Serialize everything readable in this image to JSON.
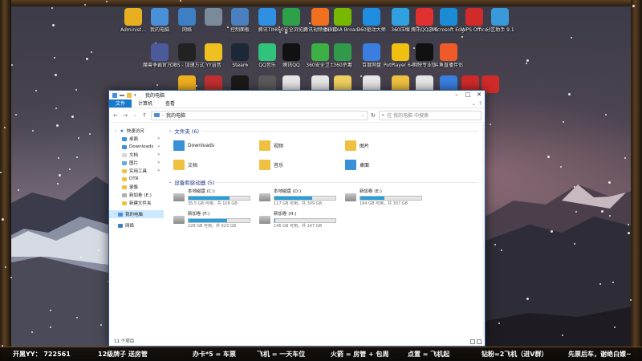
{
  "desktop": {
    "icons": [
      {
        "label": "Administ...",
        "color": "#e8b020",
        "glyph": "",
        "icon": "user-folder-icon"
      },
      {
        "label": "我的电脑",
        "color": "#4a90d9",
        "glyph": "",
        "icon": "computer-icon"
      },
      {
        "label": "网络",
        "color": "#3c7fc4",
        "glyph": "",
        "icon": "network-icon"
      },
      {
        "label": "",
        "color": "#7a8a9a",
        "glyph": "",
        "icon": "app-icon"
      },
      {
        "label": "控制面板",
        "color": "#4a7fc0",
        "glyph": "",
        "icon": "control-panel-icon"
      },
      {
        "label": "腾讯TIM",
        "color": "#2f8fe0",
        "glyph": "",
        "icon": "tim-icon"
      },
      {
        "label": "360安全浏览器",
        "color": "#2ea04a",
        "glyph": "",
        "icon": "360-browser-icon"
      },
      {
        "label": "腾讯视频播放器",
        "color": "#f07020",
        "glyph": "",
        "icon": "tencent-video-icon"
      },
      {
        "label": "NVIDIA Broadcast",
        "color": "#76b900",
        "glyph": "",
        "icon": "nvidia-icon"
      },
      {
        "label": "360驱动大师",
        "color": "#1f8de0",
        "glyph": "",
        "icon": "360-driver-icon"
      },
      {
        "label": "360压缩",
        "color": "#2fa0e0",
        "glyph": "",
        "icon": "360-zip-icon"
      },
      {
        "label": "腾讯QQ游戏",
        "color": "#e03030",
        "glyph": "",
        "icon": "qq-game-icon"
      },
      {
        "label": "Microsoft Edge",
        "color": "#1b8bd6",
        "glyph": "",
        "icon": "edge-icon"
      },
      {
        "label": "WPS Office",
        "color": "#d02a2a",
        "glyph": "",
        "icon": "wps-icon"
      },
      {
        "label": "分区助手 9.1",
        "color": "#3a9ad9",
        "glyph": "",
        "icon": "partition-icon"
      },
      {
        "label": "魔兽争霸官方对战平台",
        "color": "#4a5a9a",
        "glyph": "",
        "icon": "warcraft-icon"
      },
      {
        "label": "OBS - 加速方式",
        "color": "#222222",
        "glyph": "",
        "icon": "obs-icon"
      },
      {
        "label": "YY语音",
        "color": "#f0c020",
        "glyph": "",
        "icon": "yy-icon"
      },
      {
        "label": "Steam",
        "color": "#1b2838",
        "glyph": "",
        "icon": "steam-icon"
      },
      {
        "label": "QQ音乐",
        "color": "#31c27c",
        "glyph": "",
        "icon": "qq-music-icon"
      },
      {
        "label": "腾讯QQ",
        "color": "#111111",
        "glyph": "",
        "icon": "qq-icon"
      },
      {
        "label": "360安全卫士",
        "color": "#3cb045",
        "glyph": "",
        "icon": "360-safe-icon"
      },
      {
        "label": "360杀毒",
        "color": "#2e9a4a",
        "glyph": "",
        "icon": "360-antivirus-icon"
      },
      {
        "label": "百度网盘",
        "color": "#3a7fe0",
        "glyph": "",
        "icon": "baidu-disk-icon"
      },
      {
        "label": "PotPlayer 64 bit",
        "color": "#f0c010",
        "glyph": "",
        "icon": "potplayer-icon"
      },
      {
        "label": "剪映专业版",
        "color": "#111111",
        "glyph": "",
        "icon": "jianying-icon"
      },
      {
        "label": "斗鱼直播伴侣",
        "color": "#f05a28",
        "glyph": "",
        "icon": "douyu-icon"
      },
      {
        "label": "",
        "color": "#f0b020",
        "glyph": "",
        "icon": "app-icon"
      },
      {
        "label": "",
        "color": "#c03030",
        "glyph": "",
        "icon": "app-icon"
      },
      {
        "label": "",
        "color": "#1a1a1a",
        "glyph": "",
        "icon": "app-icon"
      },
      {
        "label": "",
        "color": "#5a5a5a",
        "glyph": "",
        "icon": "app-icon"
      },
      {
        "label": "",
        "color": "#e6e6e6",
        "glyph": "",
        "icon": "document-icon"
      },
      {
        "label": "",
        "color": "#e6e6e6",
        "glyph": "",
        "icon": "document-icon"
      },
      {
        "label": "",
        "color": "#f0d060",
        "glyph": "",
        "icon": "document-icon"
      },
      {
        "label": "",
        "color": "#e6e6e6",
        "glyph": "",
        "icon": "document-icon"
      },
      {
        "label": "",
        "color": "#f0c040",
        "glyph": "",
        "icon": "document-icon"
      },
      {
        "label": "",
        "color": "#e6e6e6",
        "glyph": "",
        "icon": "document-icon"
      },
      {
        "label": "",
        "color": "#3a7fe0",
        "glyph": "",
        "icon": "document-icon"
      },
      {
        "label": "",
        "color": "#d02a2a",
        "glyph": "",
        "icon": "app-icon"
      },
      {
        "label": "",
        "color": "#d02a2a",
        "glyph": "",
        "icon": "app-icon"
      }
    ]
  },
  "window": {
    "title": "我的电脑",
    "ribbon_tabs": [
      "文件",
      "计算机",
      "查看"
    ],
    "address": "我的电脑",
    "search_placeholder": "在 我的电脑 中搜索",
    "nav": {
      "quick_access": "快速访问",
      "items": [
        {
          "label": "桌面",
          "color": "#3a8fd9",
          "pinned": true
        },
        {
          "label": "Downloads",
          "color": "#3a8fd9",
          "pinned": true
        },
        {
          "label": "文档",
          "color": "#d9d9d9",
          "pinned": true
        },
        {
          "label": "图片",
          "color": "#5ab0e0",
          "pinned": true
        },
        {
          "label": "实用工具",
          "color": "#f0c040",
          "pinned": true
        },
        {
          "label": "DTR",
          "color": "#f0c040",
          "pinned": false
        },
        {
          "label": "录像",
          "color": "#f0c040",
          "pinned": false
        },
        {
          "label": "新加卷 (E:)",
          "color": "#b0b0b0",
          "pinned": false
        },
        {
          "label": "新建文件夹",
          "color": "#f0c040",
          "pinned": false
        }
      ],
      "this_pc": "我的电脑",
      "network": "网络"
    },
    "folders_header": "文件夹 (6)",
    "folders": [
      {
        "label": "Downloads",
        "color": "#3a8fd9"
      },
      {
        "label": "视频",
        "color": "#f0c040"
      },
      {
        "label": "图片",
        "color": "#f0c040"
      },
      {
        "label": "文档",
        "color": "#f0c040"
      },
      {
        "label": "音乐",
        "color": "#f0c040"
      },
      {
        "label": "桌面",
        "color": "#3a8fd9"
      }
    ],
    "drives_header": "设备和驱动器 (5)",
    "drives": [
      {
        "name": "本地磁盘 (C:)",
        "free": "35.5 GB 可用，共 108 GB",
        "used_fraction": 0.67
      },
      {
        "name": "本地磁盘 (D:)",
        "free": "117 GB 可用，共 309 GB",
        "used_fraction": 0.62
      },
      {
        "name": "新加卷 (E:)",
        "free": "184 GB 可用，共 307 GB",
        "used_fraction": 0.4
      },
      {
        "name": "新加卷 (F:)",
        "free": "228 GB 可用，共 623 GB",
        "used_fraction": 0.63
      },
      {
        "name": "新加卷 (H:)",
        "free": "146 GB 可用，共 147 GB",
        "used_fraction": 0.01
      }
    ],
    "status": "11 个项目"
  },
  "overlay": {
    "texts": [
      "开黑YY： 722561",
      "12级牌子 送房管",
      "办卡*5 = 车票",
      "飞机 = 一天车位",
      "火箭 = 房管 + 包周",
      "点置 = 飞机起",
      "钻粉=2飞机（进V群）",
      "先票后车，谢绝白嫖~"
    ]
  }
}
